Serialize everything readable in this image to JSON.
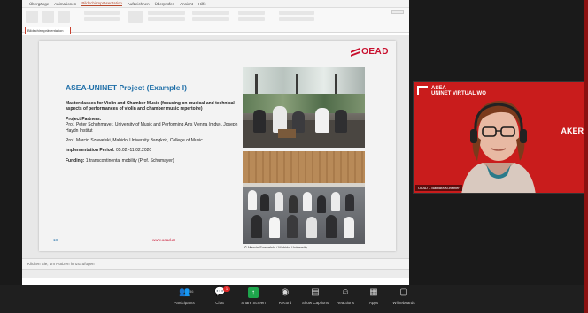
{
  "ppt": {
    "tabs": [
      "Übergänge",
      "Animationen",
      "Bildschirmpräsentation",
      "Aufzeichnen",
      "Überprüfen",
      "Ansicht",
      "Hilfe"
    ],
    "active_tab": "Bildschirmpräsentation",
    "name_box": "Bildschirmpräsentation"
  },
  "slide": {
    "logo": "OEAD",
    "title": "ASEA-UNINET Project (Example I)",
    "description": "Masterclasses for Violin and Chamber Music (focusing on musical and technical aspects of performances of violin and chamber music repertoire)",
    "partners_label": "Project Partners:",
    "partner1": "Prof. Peter Schuhmayer, University of Music and Performing Arts Vienna (mdw), Joseph Haydn Institut",
    "partner2": "Prof. Marcin Szawelski, Mahidol University Bangkok, College of Music",
    "period_label": "Implementation Period:",
    "period_value": "05.02.-11.02.2020",
    "funding_label": "Funding:",
    "funding_value": "1 transcontinental mobility (Prof. Schumayer)",
    "page_number": "18",
    "url": "www.oead.at",
    "photo_credit": "© Marcin Szawelski / Mahidol University"
  },
  "notes": "Klicken Sie, um Notizen hinzuzufügen",
  "speaker": {
    "banner_logo": "ASEA",
    "banner_title": "UNINET VIRTUAL WO",
    "banner_speaker": "AKER",
    "name": "OeAD – Barbara Kunstner"
  },
  "toolbar": {
    "participants_label": "Participants",
    "participants_count": "36",
    "chat_label": "Chat",
    "chat_badge": "1",
    "share_label": "Share Screen",
    "record_label": "Record",
    "cc_label": "Show Captions",
    "reactions_label": "Reactions",
    "apps_label": "Apps",
    "whiteboards_label": "Whiteboards"
  },
  "colors": {
    "oead_red": "#c8102e",
    "title_blue": "#1f6fa8",
    "speaker_bg": "#c91c1c",
    "share_green": "#1ea54c"
  }
}
